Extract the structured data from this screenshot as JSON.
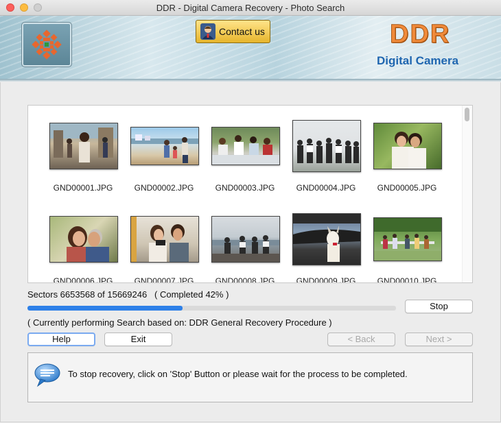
{
  "window": {
    "title": "DDR - Digital Camera Recovery - Photo Search"
  },
  "header": {
    "contact_label": "Contact us",
    "brand_name": "DDR",
    "brand_sub": "Digital Camera"
  },
  "gallery": {
    "files": [
      {
        "name": "GND00001.JPG"
      },
      {
        "name": "GND00002.JPG"
      },
      {
        "name": "GND00003.JPG"
      },
      {
        "name": "GND00004.JPG"
      },
      {
        "name": "GND00005.JPG"
      },
      {
        "name": "GND00006.JPG"
      },
      {
        "name": "GND00007.JPG"
      },
      {
        "name": "GND00008.JPG"
      },
      {
        "name": "GND00009.JPG"
      },
      {
        "name": "GND00010.JPG"
      }
    ]
  },
  "status": {
    "sectors_text": "Sectors 6653568 of 15669246   ( Completed 42% )",
    "progress_fraction": 0.42,
    "procedure_text": "( Currently performing Search based on: DDR General Recovery Procedure )"
  },
  "buttons": {
    "stop": "Stop",
    "help": "Help",
    "exit": "Exit",
    "back": "< Back",
    "next": "Next >"
  },
  "info": {
    "message": "To stop recovery, click on 'Stop' Button or please wait for the process to be completed."
  },
  "colors": {
    "progress_fill": "#2d80e8",
    "brand_orange": "#f08a3a",
    "brand_blue": "#1f66b0"
  }
}
